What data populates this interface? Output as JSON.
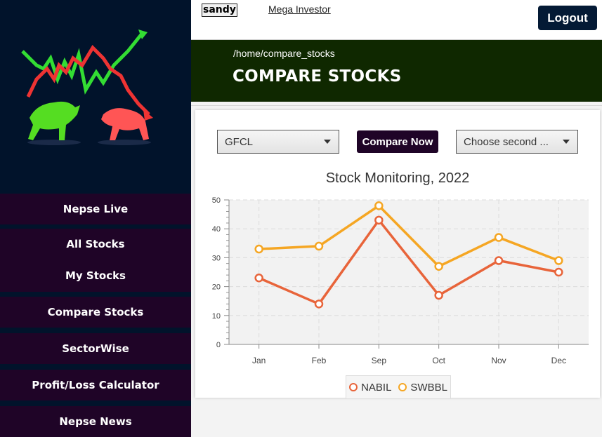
{
  "header": {
    "username": "sandy",
    "app_link": "Mega Investor",
    "logout_label": "Logout"
  },
  "banner": {
    "breadcrumb": "/home/compare_stocks",
    "title": "COMPARE STOCKS"
  },
  "sidebar": {
    "items": [
      {
        "label": "Nepse Live"
      },
      {
        "label": "All Stocks"
      },
      {
        "label": "My Stocks"
      },
      {
        "label": "Compare Stocks"
      },
      {
        "label": "SectorWise"
      },
      {
        "label": "Profit/Loss Calculator"
      },
      {
        "label": "Nepse News"
      }
    ]
  },
  "controls": {
    "first_stock": "GFCL",
    "compare_label": "Compare Now",
    "second_stock_placeholder": "Choose second ..."
  },
  "colors": {
    "nabil": "#e8643a",
    "swbbl": "#f5a623",
    "sidebar_bg": "#01132b",
    "nav_bg": "#1f0427",
    "banner_bg": "#0f2800"
  },
  "chart_data": {
    "type": "line",
    "title": "Stock Monitoring, 2022",
    "categories": [
      "Jan",
      "Feb",
      "Sep",
      "Oct",
      "Nov",
      "Dec"
    ],
    "yticks": [
      "0",
      "10",
      "20",
      "30",
      "40",
      "50"
    ],
    "ylim": [
      0,
      50
    ],
    "grid": true,
    "legend": "bottom",
    "series": [
      {
        "name": "NABIL",
        "values": [
          23,
          14,
          43,
          17,
          29,
          25
        ]
      },
      {
        "name": "SWBBL",
        "values": [
          33,
          34,
          48,
          27,
          37,
          29
        ]
      }
    ]
  }
}
